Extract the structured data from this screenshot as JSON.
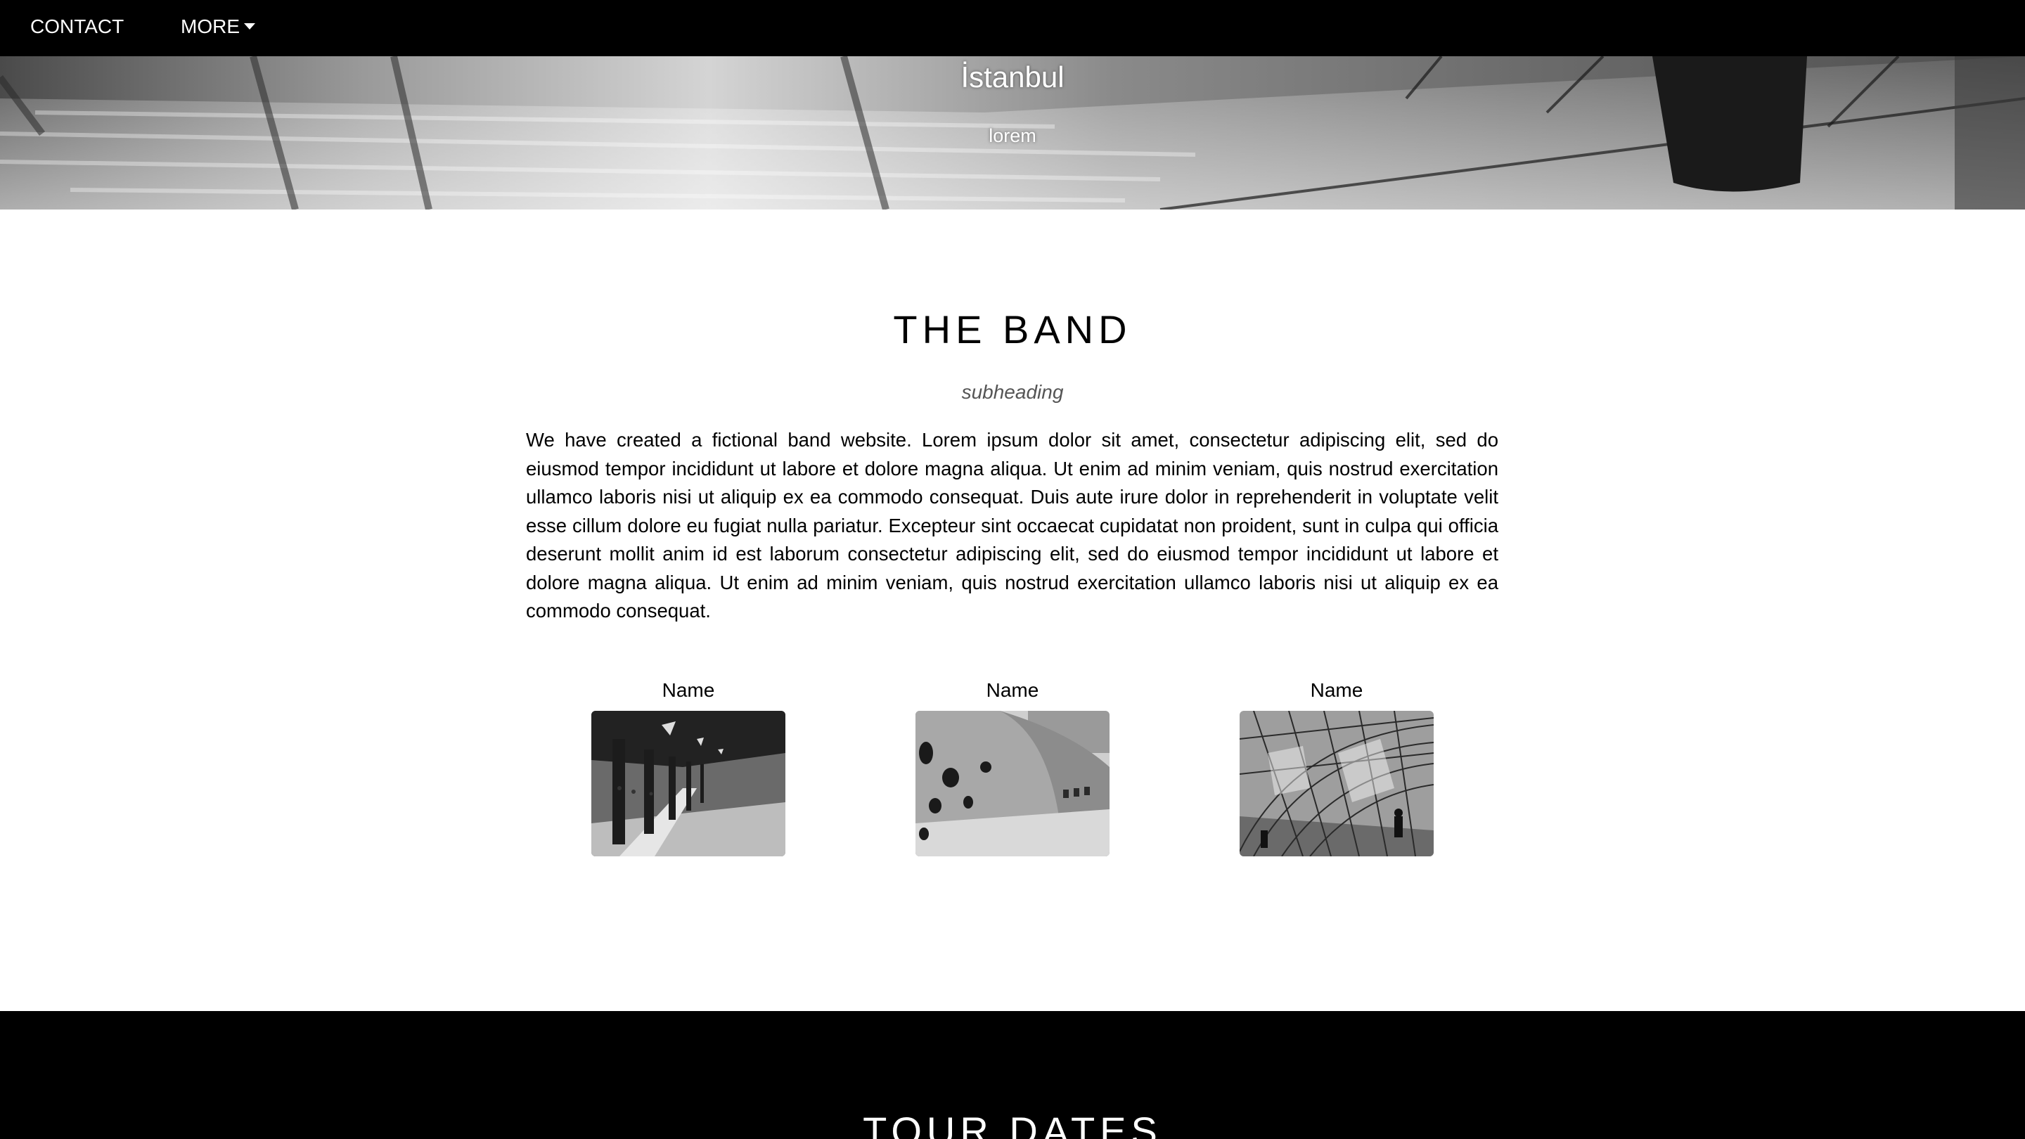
{
  "nav": {
    "items": [
      {
        "label": "CONTACT"
      },
      {
        "label": "MORE"
      }
    ]
  },
  "hero": {
    "title": "İstanbul",
    "subtitle": "lorem"
  },
  "band": {
    "heading": "THE BAND",
    "subheading": "subheading",
    "text": "We have created a fictional band website. Lorem ipsum dolor sit amet, consectetur adipiscing elit, sed do eiusmod tempor incididunt ut labore et dolore magna aliqua. Ut enim ad minim veniam, quis nostrud exercitation ullamco laboris nisi ut aliquip ex ea commodo consequat. Duis aute irure dolor in reprehenderit in voluptate velit esse cillum dolore eu fugiat nulla pariatur. Excepteur sint occaecat cupidatat non proident, sunt in culpa qui officia deserunt mollit anim id est laborum consectetur adipiscing elit, sed do eiusmod tempor incididunt ut labore et dolore magna aliqua. Ut enim ad minim veniam, quis nostrud exercitation ullamco laboris nisi ut aliquip ex ea commodo consequat.",
    "members": [
      {
        "name": "Name"
      },
      {
        "name": "Name"
      },
      {
        "name": "Name"
      }
    ]
  },
  "tour": {
    "heading": "TOUR DATES"
  },
  "colors": {
    "navbar": "#000000",
    "nav_text": "#ffffff",
    "page_bg": "#ffffff",
    "subheading": "#555555",
    "tour_bg": "#000000"
  },
  "icons": {
    "more_caret": "caret-down-icon"
  }
}
